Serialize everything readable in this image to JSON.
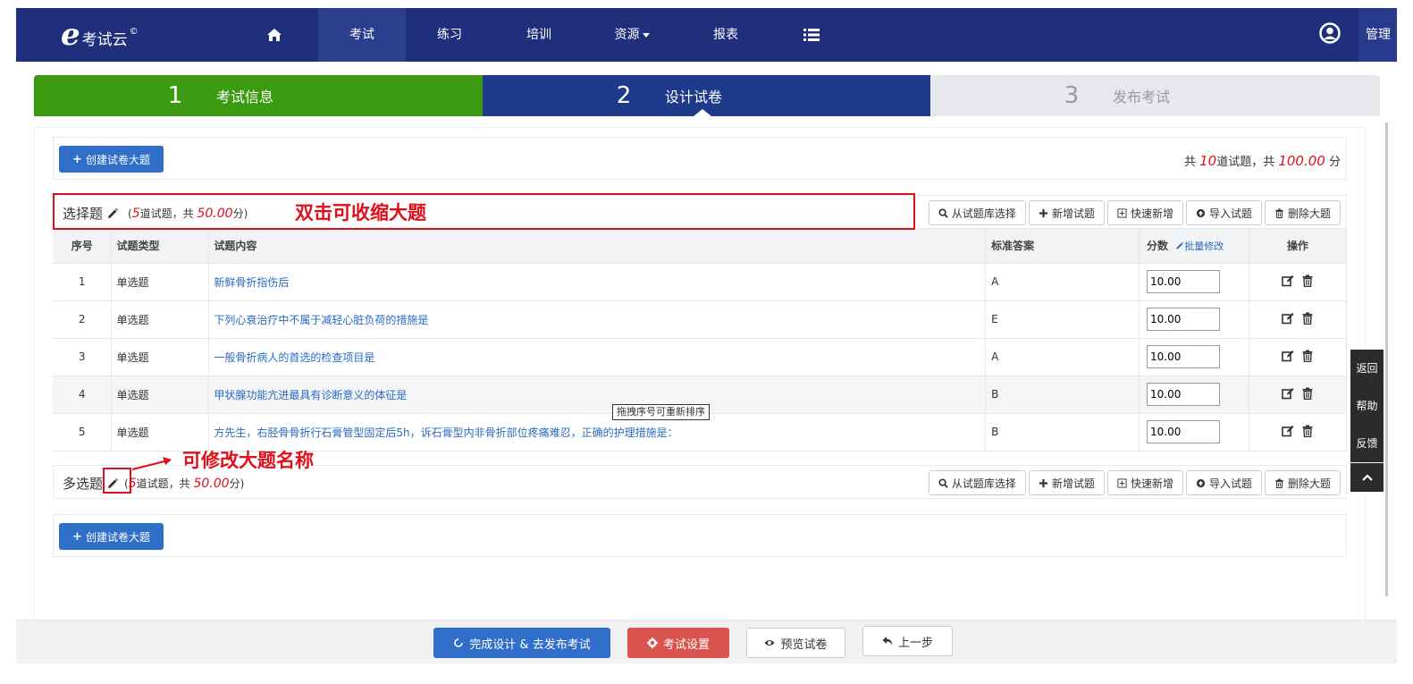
{
  "nav": {
    "logo_text": "考试云",
    "logo_mark": "©",
    "items": [
      {
        "label": "",
        "icon": "home-icon"
      },
      {
        "label": "考试",
        "active": true
      },
      {
        "label": "练习"
      },
      {
        "label": "培训"
      },
      {
        "label": "资源",
        "dropdown": true
      },
      {
        "label": "报表"
      },
      {
        "label": "",
        "icon": "list-icon"
      }
    ],
    "user_label": "管理"
  },
  "steps": [
    {
      "num": "1",
      "label": "考试信息",
      "state": "done"
    },
    {
      "num": "2",
      "label": "设计试卷",
      "state": "current"
    },
    {
      "num": "3",
      "label": "发布考试",
      "state": "pending"
    }
  ],
  "toolbar": {
    "create_label": "创建试卷大题",
    "summary_pre": "共",
    "total_questions": "10",
    "summary_mid": "道试题，共",
    "total_score": "100.00",
    "summary_post": "分"
  },
  "section_buttons": {
    "from_bank": "从试题库选择",
    "add": "新增试题",
    "quick_add": "快速新增",
    "import": "导入试题",
    "delete": "删除大题"
  },
  "sections": [
    {
      "title": "选择题",
      "meta_pre": "(",
      "count": "5",
      "meta_mid": "道试题，共",
      "score": "50.00",
      "meta_post": "分)"
    },
    {
      "title": "多选题",
      "meta_pre": "(",
      "count": "5",
      "meta_mid": "道试题，共",
      "score": "50.00",
      "meta_post": "分)"
    }
  ],
  "table": {
    "headers": {
      "no": "序号",
      "type": "试题类型",
      "content": "试题内容",
      "answer": "标准答案",
      "score": "分数",
      "batch_edit": "批量修改",
      "op": "操作"
    },
    "rows": [
      {
        "no": "1",
        "type": "单选题",
        "content": "新鲜骨折指伤后",
        "answer": "A",
        "score": "10.00"
      },
      {
        "no": "2",
        "type": "单选题",
        "content": "下列心衰治疗中不属于减轻心脏负荷的措施是",
        "answer": "E",
        "score": "10.00"
      },
      {
        "no": "3",
        "type": "单选题",
        "content": "一般骨折病人的首选的检查项目是",
        "answer": "A",
        "score": "10.00"
      },
      {
        "no": "4",
        "type": "单选题",
        "content": "甲状腺功能亢进最具有诊断意义的体征是",
        "answer": "B",
        "score": "10.00"
      },
      {
        "no": "5",
        "type": "单选题",
        "content": "方先生，右胫骨骨折行石膏管型固定后5h，诉石膏型内非骨折部位疼痛难忍，正确的护理措施是：",
        "answer": "B",
        "score": "10.00"
      }
    ]
  },
  "tooltip": "拖拽序号可重新排序",
  "annotations": {
    "collapse_hint": "双击可收缩大题",
    "rename_hint": "可修改大题名称"
  },
  "bottom_create_label": "创建试卷大题",
  "footer": {
    "finish": "完成设计 & 去发布考试",
    "settings": "考试设置",
    "preview": "预览试卷",
    "prev": "上一步"
  },
  "side": {
    "back": "返回",
    "help": "帮助",
    "feedback": "反馈"
  },
  "colors": {
    "nav_bg": "#1f2f7c",
    "step_done": "#3b9a10",
    "step_current": "#1e3a8a",
    "step_pending": "#e6e8ec",
    "primary": "#2f6fc9",
    "danger": "#d9534f",
    "annotation": "#e0101a"
  }
}
